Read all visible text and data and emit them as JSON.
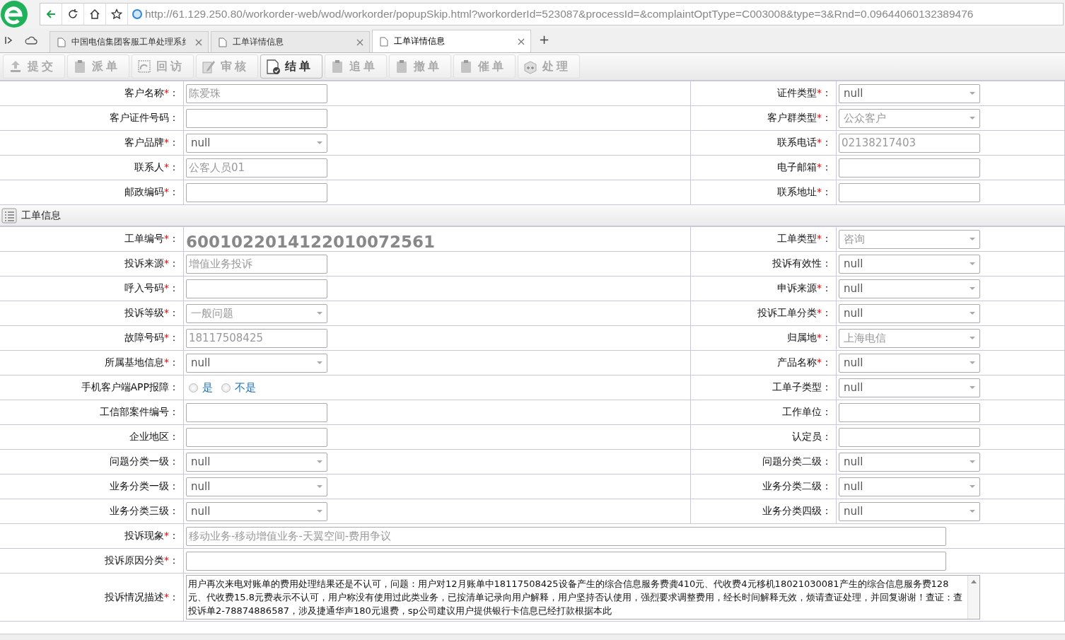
{
  "browser": {
    "url": "http://61.129.250.80/workorder-web/wod/workorder/popupSkip.html?workorderId=523087&processId=&complaintOptType=C003008&type=3&Rnd=0.09644060132389476",
    "tabs": [
      {
        "title": "中国电信集团客服工单处理系纟",
        "selected": false
      },
      {
        "title": "工单详情信息",
        "selected": false
      },
      {
        "title": "工单详情信息",
        "selected": true
      }
    ],
    "new_tab": "+"
  },
  "toolbar": [
    {
      "label": "提交",
      "disabled": true
    },
    {
      "label": "派单",
      "disabled": true
    },
    {
      "label": "回访",
      "disabled": true
    },
    {
      "label": "审核",
      "disabled": true
    },
    {
      "label": "结单",
      "disabled": false
    },
    {
      "label": "追单",
      "disabled": true
    },
    {
      "label": "撤单",
      "disabled": true
    },
    {
      "label": "催单",
      "disabled": true
    },
    {
      "label": "处理",
      "disabled": true
    }
  ],
  "form": [
    {
      "kind": "row",
      "cells": [
        {
          "label": "客户名称",
          "star": "*",
          "colon": "：",
          "control": {
            "kind": "input",
            "value": "陈爱珠",
            "disabled": true
          }
        },
        {
          "label": "证件类型",
          "star": "*",
          "colon": "：",
          "control": {
            "kind": "select",
            "value": "null",
            "disabled": false
          }
        }
      ]
    },
    {
      "kind": "row",
      "cells": [
        {
          "label": "客户证件号码",
          "colon": "：",
          "control": {
            "kind": "input"
          }
        },
        {
          "label": "客户群类型",
          "star": "*",
          "colon": "：",
          "control": {
            "kind": "select",
            "value": "公众客户",
            "disabled": true
          }
        }
      ]
    },
    {
      "kind": "row",
      "cells": [
        {
          "label": "客户品牌",
          "star": "*",
          "colon": "：",
          "control": {
            "kind": "select",
            "value": "null",
            "disabled": false
          }
        },
        {
          "label": "联系电话",
          "star": "*",
          "colon": "：",
          "control": {
            "kind": "input",
            "value": "02138217403",
            "disabled": true
          }
        }
      ]
    },
    {
      "kind": "row",
      "cells": [
        {
          "label": "联系人",
          "star": "*",
          "colon": "：",
          "control": {
            "kind": "input",
            "value": "公客人员01",
            "disabled": true
          }
        },
        {
          "label": "电子邮箱",
          "star": "*",
          "colon": "：",
          "control": {
            "kind": "input"
          }
        }
      ]
    },
    {
      "kind": "row",
      "cells": [
        {
          "label": "邮政编码",
          "star": "*",
          "colon": "：",
          "control": {
            "kind": "input"
          }
        },
        {
          "label": "联系地址",
          "star": "*",
          "colon": "：",
          "control": {
            "kind": "input"
          }
        }
      ]
    },
    {
      "kind": "section",
      "title": "工单信息"
    },
    {
      "kind": "row",
      "cells": [
        {
          "label": "工单编号",
          "star": "*",
          "colon": "：",
          "control": {
            "kind": "number",
            "value": "6001022014122010072561"
          }
        },
        {
          "label": "工单类型",
          "star": "*",
          "colon": "：",
          "control": {
            "kind": "select",
            "value": "咨询",
            "disabled": true
          }
        }
      ]
    },
    {
      "kind": "row",
      "cells": [
        {
          "label": "投诉来源",
          "star": "*",
          "colon": "：",
          "control": {
            "kind": "input",
            "value": "增值业务投诉",
            "disabled": true
          }
        },
        {
          "label": "投诉有效性",
          "colon": "：",
          "control": {
            "kind": "select",
            "value": "null",
            "disabled": false
          }
        }
      ]
    },
    {
      "kind": "row",
      "cells": [
        {
          "label": "呼入号码",
          "star": "*",
          "colon": "：",
          "control": {
            "kind": "input"
          }
        },
        {
          "label": "申诉来源",
          "star": "*",
          "colon": "：",
          "control": {
            "kind": "select",
            "value": "null",
            "disabled": false
          }
        }
      ]
    },
    {
      "kind": "row",
      "cells": [
        {
          "label": "投诉等级",
          "star": "*",
          "colon": "：",
          "control": {
            "kind": "select",
            "value": "一般问题",
            "disabled": true
          }
        },
        {
          "label": "投诉工单分类",
          "star": "*",
          "colon": "：",
          "control": {
            "kind": "select",
            "value": "null",
            "disabled": false
          }
        }
      ]
    },
    {
      "kind": "row",
      "cells": [
        {
          "label": "故障号码",
          "star": "*",
          "colon": "：",
          "control": {
            "kind": "input",
            "value": "18117508425",
            "disabled": true
          }
        },
        {
          "label": "归属地",
          "star": "*",
          "colon": "：",
          "control": {
            "kind": "select",
            "value": "上海电信",
            "disabled": true
          }
        }
      ]
    },
    {
      "kind": "row",
      "cells": [
        {
          "label": "所属基地信息",
          "star": "*",
          "colon": "：",
          "control": {
            "kind": "select",
            "value": "null",
            "disabled": false
          }
        },
        {
          "label": "产品名称",
          "star": "*",
          "colon": "：",
          "control": {
            "kind": "select",
            "value": "null",
            "disabled": false
          }
        }
      ]
    },
    {
      "kind": "row",
      "cells": [
        {
          "label": "手机客户端APP报障",
          "colon": "：",
          "control": {
            "kind": "radio",
            "options": [
              {
                "label": "是",
                "selected": false
              },
              {
                "label": "不是",
                "selected": false
              }
            ]
          }
        },
        {
          "label": "工单子类型",
          "colon": "：",
          "control": {
            "kind": "select",
            "value": "null",
            "disabled": false
          }
        }
      ]
    },
    {
      "kind": "row",
      "cells": [
        {
          "label": "工信部案件编号",
          "colon": "：",
          "control": {
            "kind": "input"
          }
        },
        {
          "label": "工作单位",
          "colon": "：",
          "control": {
            "kind": "input"
          }
        }
      ]
    },
    {
      "kind": "row",
      "cells": [
        {
          "label": "企业地区",
          "colon": "：",
          "control": {
            "kind": "input"
          }
        },
        {
          "label": "认定员",
          "colon": "：",
          "control": {
            "kind": "input"
          }
        }
      ]
    },
    {
      "kind": "row",
      "cells": [
        {
          "label": "问题分类一级",
          "colon": "：",
          "control": {
            "kind": "select",
            "value": "null",
            "disabled": false
          }
        },
        {
          "label": "问题分类二级",
          "colon": "：",
          "control": {
            "kind": "select",
            "value": "null",
            "disabled": false
          }
        }
      ]
    },
    {
      "kind": "row",
      "cells": [
        {
          "label": "业务分类一级",
          "colon": "：",
          "control": {
            "kind": "select",
            "value": "null",
            "disabled": false
          }
        },
        {
          "label": "业务分类二级",
          "colon": "：",
          "control": {
            "kind": "select",
            "value": "null",
            "disabled": false
          }
        }
      ]
    },
    {
      "kind": "row",
      "cells": [
        {
          "label": "业务分类三级",
          "colon": "：",
          "control": {
            "kind": "select",
            "value": "null",
            "disabled": false
          }
        },
        {
          "label": "业务分类四级",
          "colon": "：",
          "control": {
            "kind": "select",
            "value": "null",
            "disabled": false
          }
        }
      ]
    },
    {
      "kind": "wide",
      "cells": [
        {
          "label": "投诉现象",
          "star": "*",
          "colon": "：",
          "control": {
            "kind": "input",
            "value": "移动业务-移动增值业务-天翼空间-费用争议",
            "disabled": true
          }
        }
      ]
    },
    {
      "kind": "wide",
      "cells": [
        {
          "label": "投诉原因分类",
          "star": "*",
          "colon": "：",
          "control": {
            "kind": "input"
          }
        }
      ]
    },
    {
      "kind": "wide",
      "cells": [
        {
          "label": "投诉情况描述",
          "star": "*",
          "colon": "：",
          "control": {
            "kind": "textarea",
            "value": "用户再次来电对账单的费用处理结果还是不认可，问题：用户对12月账单中18117508425设备产生的综合信息服务费龚410元、代收费4元移机18021030081产生的综合信息服务费128元、代收费15.8元费表示不认可，用户称没有使用过此类业务，已按清单记录向用户解释，用户坚持否认使用，强烈要求调整费用，经长时间解释无效，烦请查证处理，并回复谢谢！查证：查投诉单2-78874886587，涉及捷通华声180元退费，sp公司建议用户提供银行卡信息已经打款根据本此"
          }
        }
      ]
    }
  ]
}
